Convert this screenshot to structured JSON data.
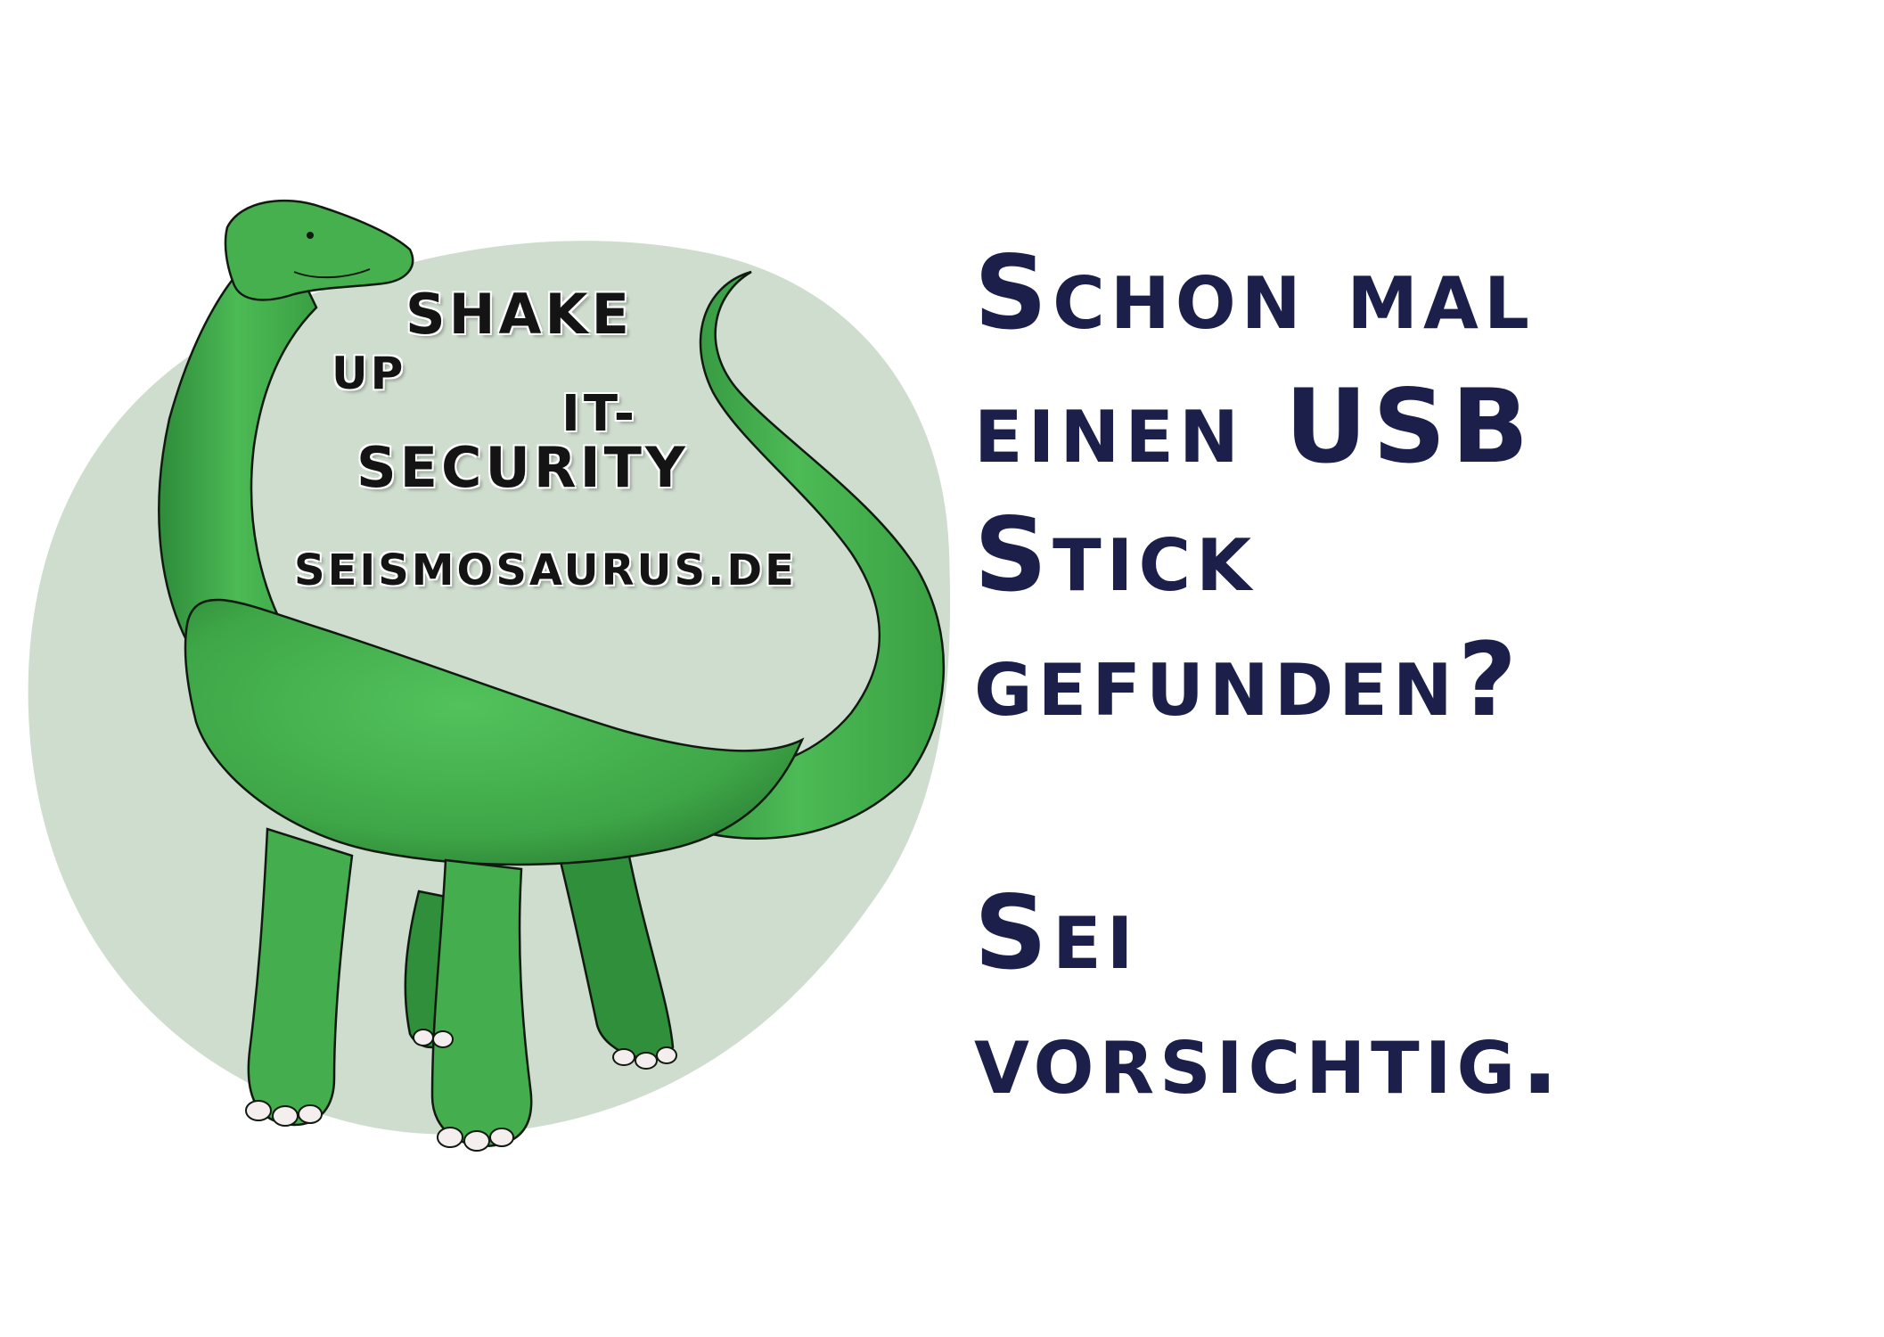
{
  "logo": {
    "line1": "SHAKE",
    "line2": "UP",
    "line3": "IT-",
    "line4": "SECURITY",
    "url": "SEISMOSAURUS.DE"
  },
  "headline": {
    "lines": [
      "Schon mal",
      "einen USB",
      "Stick",
      "gefunden?"
    ],
    "warning": [
      "Sei",
      "vorsichtig."
    ]
  },
  "colors": {
    "background": "#ffffff",
    "blob": "#cfddcf",
    "dino_body": "#46b04f",
    "dino_shade": "#2e8b3a",
    "text_dark": "#1b1f4a",
    "logo_text": "#141414"
  }
}
